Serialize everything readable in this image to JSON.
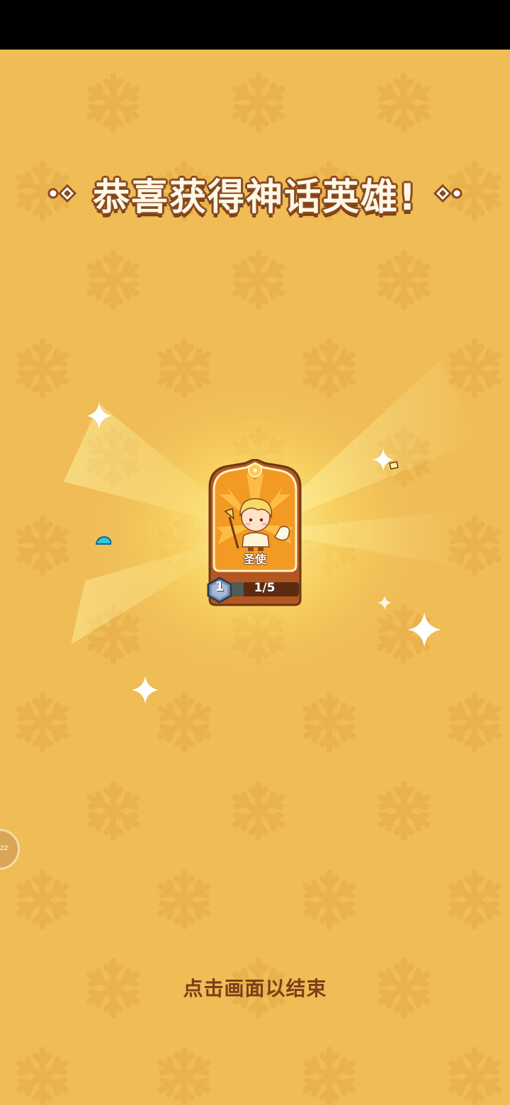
{
  "title": {
    "text": "恭喜获得神话英雄!"
  },
  "hero_card": {
    "name": "圣使",
    "level": "1",
    "progress_text": "1/5",
    "progress_fraction": 0.2
  },
  "side_button": {
    "label": "zz"
  },
  "hint": {
    "text": "点击画面以结束"
  },
  "colors": {
    "background": "#efbc56",
    "title_outline": "#8a4a1e",
    "card_orange": "#f29a24",
    "card_brown": "#b4561f",
    "progress_accent": "#3bb8d8",
    "hint_text": "#7a3f17"
  }
}
